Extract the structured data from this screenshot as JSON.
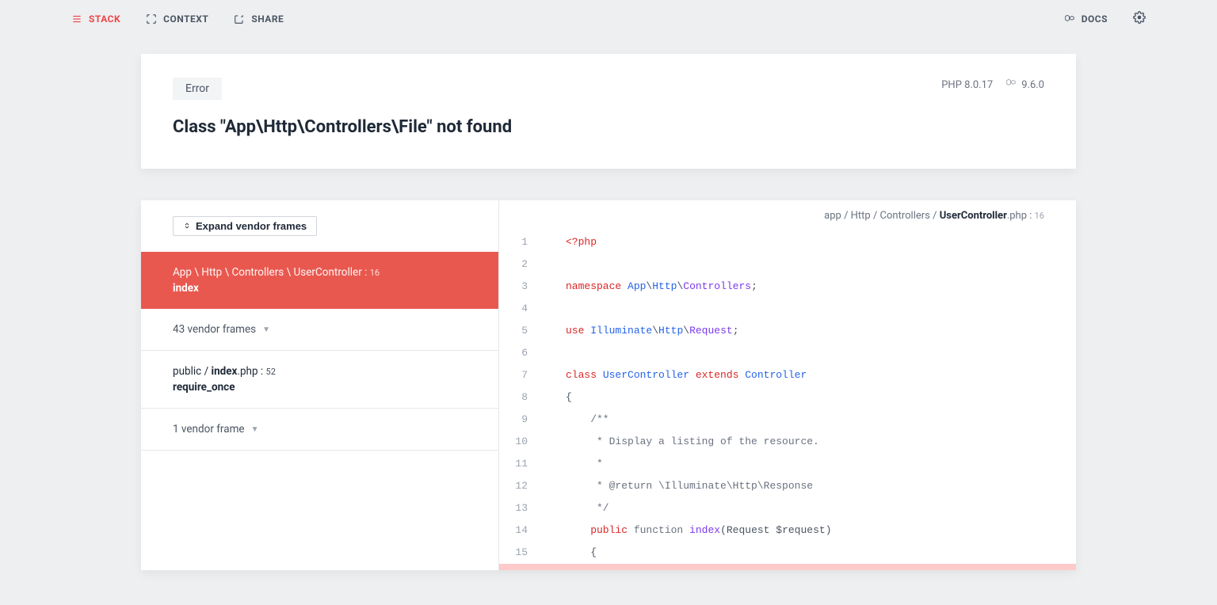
{
  "nav": {
    "stack": "STACK",
    "context": "CONTEXT",
    "share": "SHARE",
    "docs": "DOCS"
  },
  "error": {
    "badge": "Error",
    "title": "Class \"App\\Http\\Controllers\\File\" not found",
    "php_version": "PHP 8.0.17",
    "laravel_version": "9.6.0"
  },
  "frames": {
    "expand_label": "Expand vendor frames",
    "active": {
      "path_prefix": "App \\ Http \\ Controllers \\ ",
      "path_class": "UserController",
      "line": "16",
      "method": "index"
    },
    "vendor1": "43 vendor frames",
    "public_frame": {
      "prefix": "public / ",
      "bold": "index",
      "suffix": ".php",
      "line": "52",
      "method": "require_once"
    },
    "vendor2": "1 vendor frame"
  },
  "source_file": {
    "path_prefix": "app / Http / Controllers / ",
    "filename": "UserController",
    "ext": ".php",
    "line": "16"
  },
  "code": {
    "lines": [
      "1",
      "2",
      "3",
      "4",
      "5",
      "6",
      "7",
      "8",
      "9",
      "10",
      "11",
      "12",
      "13",
      "14",
      "15"
    ],
    "l1_tag": "<?php",
    "l3_kw": "namespace ",
    "l3_ns1": "App",
    "l3_s1": "\\",
    "l3_ns2": "Http",
    "l3_s2": "\\",
    "l3_ns3": "Controllers",
    "l3_end": ";",
    "l5_kw": "use ",
    "l5_ns1": "Illuminate",
    "l5_s1": "\\",
    "l5_ns2": "Http",
    "l5_s2": "\\",
    "l5_ns3": "Request",
    "l5_end": ";",
    "l7_kw1": "class ",
    "l7_cls": "UserController",
    "l7_kw2": " extends ",
    "l7_base": "Controller",
    "l8": "{",
    "l9": "    /**",
    "l10": "     * Display a listing of the resource.",
    "l11": "     *",
    "l12a": "     * @return ",
    "l12b": "\\Illuminate\\Http\\Response",
    "l13": "     */",
    "l14_kw1": "    public ",
    "l14_kw2": "function ",
    "l14_fn": "index",
    "l14_p1": "(Request ",
    "l14_var": "$request",
    "l14_p2": ")",
    "l15": "    {"
  }
}
